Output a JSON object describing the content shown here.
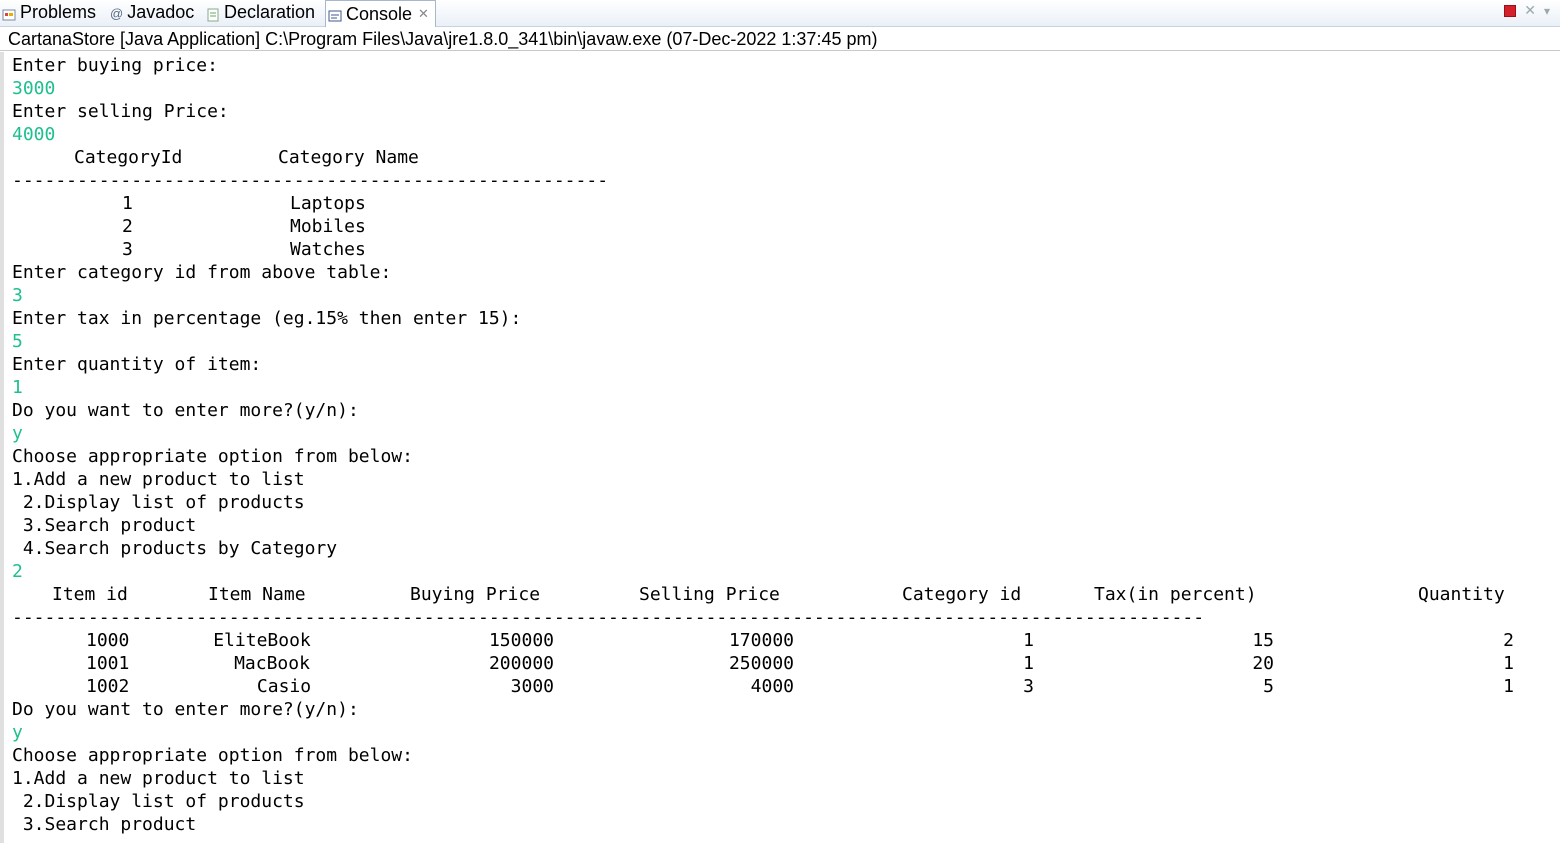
{
  "tabs": [
    {
      "label": "Problems",
      "icon": "problems-icon"
    },
    {
      "label": "Javadoc",
      "icon": "javadoc-icon"
    },
    {
      "label": "Declaration",
      "icon": "declaration-icon"
    },
    {
      "label": "Console",
      "icon": "console-icon",
      "active": true
    }
  ],
  "title": "CartanaStore [Java Application] C:\\Program Files\\Java\\jre1.8.0_341\\bin\\javaw.exe (07-Dec-2022 1:37:45 pm)",
  "console": {
    "l1": "Enter buying price:",
    "l2": "3000",
    "l3": "Enter selling Price:",
    "l4": "4000",
    "cat_header_id": "CategoryId",
    "cat_header_name": "Category Name",
    "cat_sep": "-------------------------------------------------------",
    "categories": [
      {
        "id": "1",
        "name": "Laptops"
      },
      {
        "id": "2",
        "name": "Mobiles"
      },
      {
        "id": "3",
        "name": "Watches"
      }
    ],
    "l5": "Enter category id from above table:",
    "l6": "3",
    "l7": "Enter tax in percentage (eg.15% then enter 15):",
    "l8": "5",
    "l9": "Enter quantity of item:",
    "l10": "1",
    "l11": "Do you want to enter more?(y/n):",
    "l12": "y",
    "l13": "Choose appropriate option from below:",
    "l14": "1.Add a new product to list",
    "l15": " 2.Display list of products",
    "l16": " 3.Search product",
    "l17": " 4.Search products by Category",
    "l18": "2",
    "table_headers": [
      "Item id",
      "Item Name",
      "Buying Price",
      "Selling Price",
      "Category id",
      "Tax(in percent)",
      "Quantity"
    ],
    "table_sep": "--------------------------------------------------------------------------------------------------------------",
    "rows": [
      {
        "id": "1000",
        "name": "EliteBook",
        "buy": "150000",
        "sell": "170000",
        "cat": "1",
        "tax": "15",
        "qty": "2"
      },
      {
        "id": "1001",
        "name": "MacBook",
        "buy": "200000",
        "sell": "250000",
        "cat": "1",
        "tax": "20",
        "qty": "1"
      },
      {
        "id": "1002",
        "name": "Casio",
        "buy": "3000",
        "sell": "4000",
        "cat": "3",
        "tax": "5",
        "qty": "1"
      }
    ],
    "l19": "Do you want to enter more?(y/n):",
    "l20": "y",
    "l21": "Choose appropriate option from below:",
    "l22": "1.Add a new product to list",
    "l23": " 2.Display list of products",
    "l24": " 3.Search product"
  },
  "colors": {
    "input_text": "#1fbf8f",
    "stop_button": "#d4202a"
  }
}
